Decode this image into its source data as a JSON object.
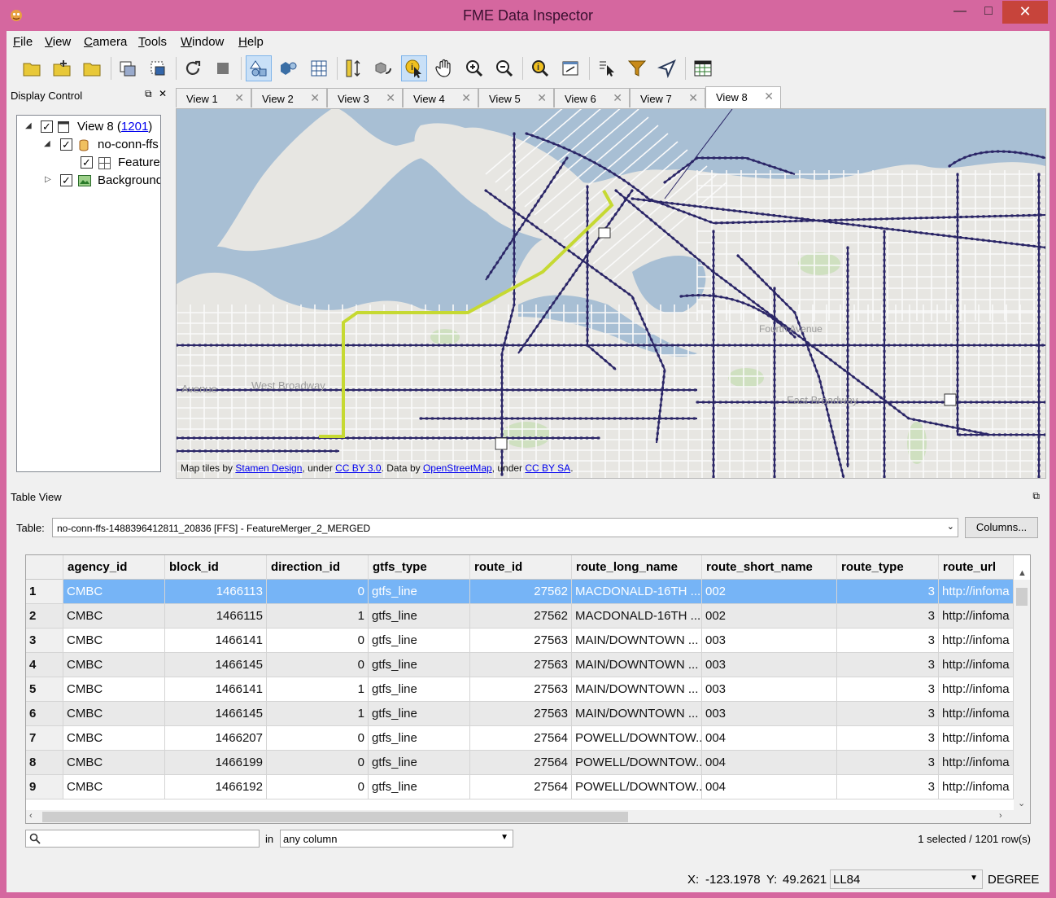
{
  "window": {
    "title": "FME Data Inspector",
    "close_glyph": "✕",
    "max_glyph": "□",
    "min_glyph": "—"
  },
  "menu": [
    {
      "key": "F",
      "rest": "ile"
    },
    {
      "key": "V",
      "rest": "iew"
    },
    {
      "key": "C",
      "rest": "amera"
    },
    {
      "key": "T",
      "rest": "ools"
    },
    {
      "key": "W",
      "rest": "indow"
    },
    {
      "key": "H",
      "rest": "elp"
    }
  ],
  "toolbar_icons": [
    "open-folder-icon",
    "open-more-icon",
    "folder-icon",
    "copy-view-icon",
    "backup-icon",
    "refresh-icon",
    "stop-icon",
    "geometry-2d-icon",
    "geometry-3d-icon",
    "grid-icon",
    "measure-icon",
    "rotate-3d-icon",
    "select-info-icon",
    "pan-icon",
    "zoom-in-icon",
    "zoom-out-icon",
    "inspect-icon",
    "zoom-extent-icon",
    "select-arrow-icon",
    "filter-icon",
    "navigate-icon",
    "table-icon"
  ],
  "display_control": {
    "title": "Display Control",
    "tree": {
      "view_label": "View 8 (",
      "view_count": "1201",
      "view_close": ")",
      "dataset": "no-conn-ffs",
      "feature_type": "FeatureM",
      "background": "Background"
    }
  },
  "tabs": [
    "View 1",
    "View 2",
    "View 3",
    "View 4",
    "View 5",
    "View 6",
    "View 7",
    "View 8"
  ],
  "active_tab": "View 8",
  "map": {
    "attr_prefix": "Map tiles by ",
    "attr_link1": "Stamen Design",
    "attr_mid1": ", under ",
    "attr_link2": "CC BY 3.0",
    "attr_mid2": ". Data by ",
    "attr_link3": "OpenStreetMap",
    "attr_mid3": ", under ",
    "attr_link4": "CC BY SA",
    "attr_end": ".",
    "labels": {
      "avenue": "Avenue",
      "west_broadway": "West Broadway",
      "east_broadway": "East Broadway",
      "fourth_ave": "Fourth Avenue"
    },
    "colors": {
      "water": "#a8bfd4",
      "land": "#e7e6e2",
      "route": "#2b2667",
      "highlight": "#c6d932"
    }
  },
  "table_view": {
    "title": "Table View",
    "table_label": "Table:",
    "table_value": "no-conn-ffs-1488396412811_20836 [FFS] - FeatureMerger_2_MERGED",
    "columns_button": "Columns...",
    "headers": [
      "agency_id",
      "block_id",
      "direction_id",
      "gtfs_type",
      "route_id",
      "route_long_name",
      "route_short_name",
      "route_type",
      "route_url"
    ],
    "rows": [
      [
        "1",
        "CMBC",
        "1466113",
        "0",
        "gtfs_line",
        "27562",
        "MACDONALD-16TH ...",
        "002",
        "3",
        "http://infoma"
      ],
      [
        "2",
        "CMBC",
        "1466115",
        "1",
        "gtfs_line",
        "27562",
        "MACDONALD-16TH ...",
        "002",
        "3",
        "http://infoma"
      ],
      [
        "3",
        "CMBC",
        "1466141",
        "0",
        "gtfs_line",
        "27563",
        "MAIN/DOWNTOWN ...",
        "003",
        "3",
        "http://infoma"
      ],
      [
        "4",
        "CMBC",
        "1466145",
        "0",
        "gtfs_line",
        "27563",
        "MAIN/DOWNTOWN ...",
        "003",
        "3",
        "http://infoma"
      ],
      [
        "5",
        "CMBC",
        "1466141",
        "1",
        "gtfs_line",
        "27563",
        "MAIN/DOWNTOWN ...",
        "003",
        "3",
        "http://infoma"
      ],
      [
        "6",
        "CMBC",
        "1466145",
        "1",
        "gtfs_line",
        "27563",
        "MAIN/DOWNTOWN ...",
        "003",
        "3",
        "http://infoma"
      ],
      [
        "7",
        "CMBC",
        "1466207",
        "0",
        "gtfs_line",
        "27564",
        "POWELL/DOWNTOW...",
        "004",
        "3",
        "http://infoma"
      ],
      [
        "8",
        "CMBC",
        "1466199",
        "0",
        "gtfs_line",
        "27564",
        "POWELL/DOWNTOW...",
        "004",
        "3",
        "http://infoma"
      ],
      [
        "9",
        "CMBC",
        "1466192",
        "0",
        "gtfs_line",
        "27564",
        "POWELL/DOWNTOW...",
        "004",
        "3",
        "http://infoma"
      ]
    ],
    "selected_row": 1,
    "search_placeholder": "",
    "in_label": "in",
    "column_filter": "any column",
    "status": "1 selected / 1201 row(s)"
  },
  "statusbar": {
    "x_label": "X:",
    "x_value": "-123.1978",
    "y_label": "Y:",
    "y_value": "49.2621",
    "crs": "LL84",
    "units": "DEGREE"
  }
}
